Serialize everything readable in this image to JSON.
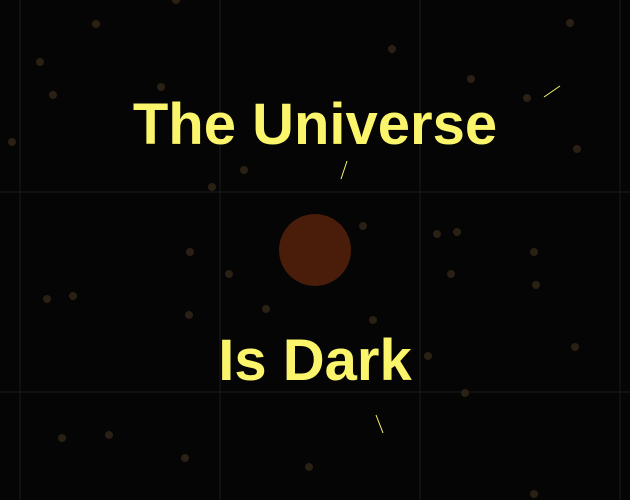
{
  "title": {
    "line1": "The Universe",
    "line2": "Is Dark"
  },
  "colors": {
    "background": "#050505",
    "grid": "#1c1c1c",
    "star": "#2a2014",
    "planet": "#4a1d0a",
    "title": "#fbf56b",
    "streak": "#fbf56b"
  }
}
